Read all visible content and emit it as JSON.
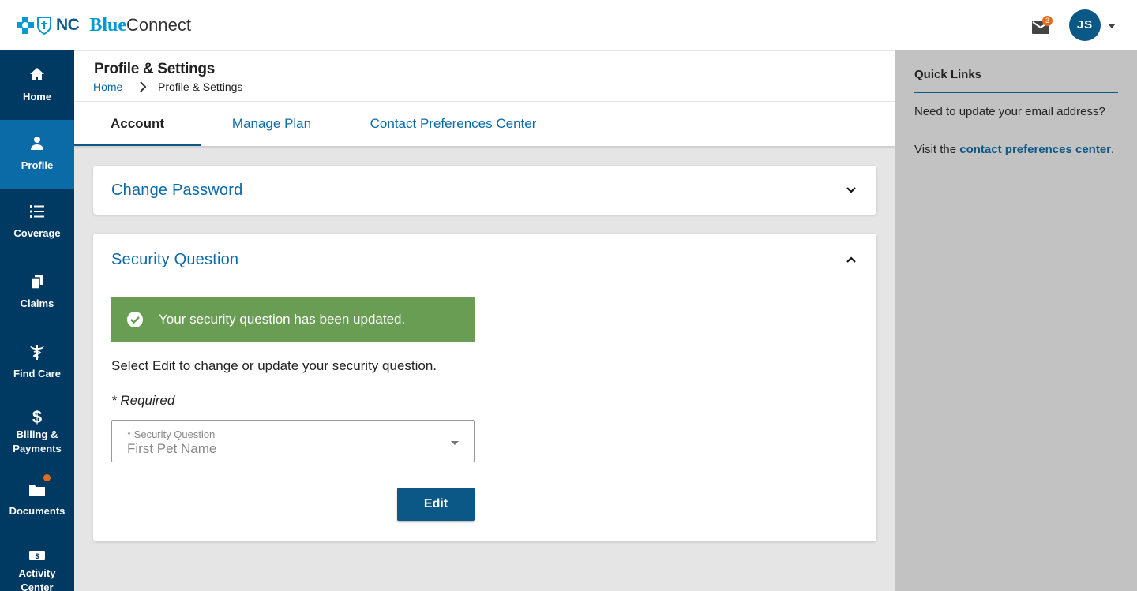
{
  "header": {
    "logo": {
      "nc": "NC",
      "blue": "Blue",
      "connect": "Connect"
    },
    "mail_badge": "3",
    "avatar_initials": "JS"
  },
  "sidebar": {
    "items": [
      {
        "label": "Home",
        "icon": "home-icon"
      },
      {
        "label": "Profile",
        "icon": "person-icon"
      },
      {
        "label": "Coverage",
        "icon": "list-icon"
      },
      {
        "label": "Claims",
        "icon": "documents-icon"
      },
      {
        "label": "Find Care",
        "icon": "caduceus-icon"
      },
      {
        "label": "Billing &",
        "label2": "Payments",
        "icon": "dollar-icon"
      },
      {
        "label": "Documents",
        "icon": "folder-icon"
      },
      {
        "label": "Activity",
        "label2": "Center",
        "icon": "card-icon"
      }
    ],
    "active": "Profile"
  },
  "page": {
    "title": "Profile & Settings",
    "breadcrumb": {
      "home": "Home",
      "sep": "›",
      "current": "Profile & Settings"
    }
  },
  "tabs": [
    {
      "label": "Account",
      "active": true
    },
    {
      "label": "Manage Plan",
      "active": false
    },
    {
      "label": "Contact Preferences Center",
      "active": false
    }
  ],
  "change_password": {
    "title": "Change Password"
  },
  "security_question": {
    "title": "Security Question",
    "success_message": "Your security question has been updated.",
    "description": "Select Edit to change or update your security question.",
    "required_note": "* Required",
    "field_label": "* Security Question",
    "field_value": "First Pet Name",
    "edit_label": "Edit"
  },
  "quick_links": {
    "title": "Quick Links",
    "text1": "Need to update your email address?",
    "text2_prefix": "Visit the ",
    "link": "contact preferences center",
    "text2_suffix": "."
  },
  "colors": {
    "brand_dark": "#003a63",
    "brand_active": "#0b6ba7",
    "success": "#6a9d54",
    "notification": "#e36c1b"
  }
}
